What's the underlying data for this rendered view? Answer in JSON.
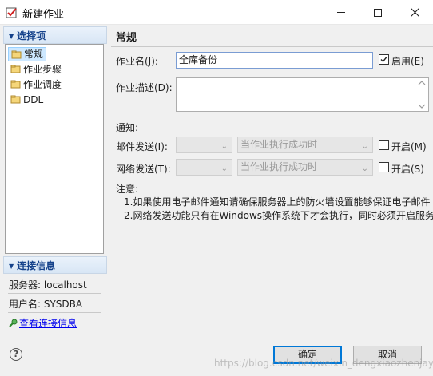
{
  "window": {
    "title": "新建作业",
    "icon": "job-app-icon"
  },
  "left": {
    "nav_header": "选择项",
    "nav_items": [
      {
        "label": "常规",
        "icon": "folder-icon",
        "selected": true
      },
      {
        "label": "作业步骤",
        "icon": "folder-icon",
        "selected": false
      },
      {
        "label": "作业调度",
        "icon": "folder-icon",
        "selected": false
      },
      {
        "label": "DDL",
        "icon": "folder-icon",
        "selected": false
      }
    ],
    "conn_header": "连接信息",
    "server": "服务器: localhost",
    "user": "用户名: SYSDBA",
    "view_conn_link": "查看连接信息"
  },
  "main": {
    "section_title": "常规",
    "job_name_label": "作业名(J):",
    "job_name_value": "全库备份",
    "enable_label": "启用(E)",
    "enable_checked": true,
    "job_desc_label": "作业描述(D):",
    "notify_label": "通知:",
    "email_label": "邮件发送(I):",
    "email_condition": "当作业执行成功时",
    "email_open_label": "开启(M)",
    "net_label": "网络发送(T):",
    "net_condition": "当作业执行成功时",
    "net_open_label": "开启(S)",
    "note_label": "注意:",
    "note_1": "1.如果使用电子邮件通知请确保服务器上的防火墙设置能够保证电子邮件",
    "note_2": "2.网络发送功能只有在Windows操作系统下才会执行，同时必须开启服务"
  },
  "footer": {
    "ok_label": "确定",
    "cancel_label": "取消",
    "watermark": "https://blog.csdn.net/weixin_dengxiaozhenjay"
  },
  "colors": {
    "accent": "#0078d7",
    "panel_header_text": "#15428b",
    "link": "#0000ee"
  }
}
